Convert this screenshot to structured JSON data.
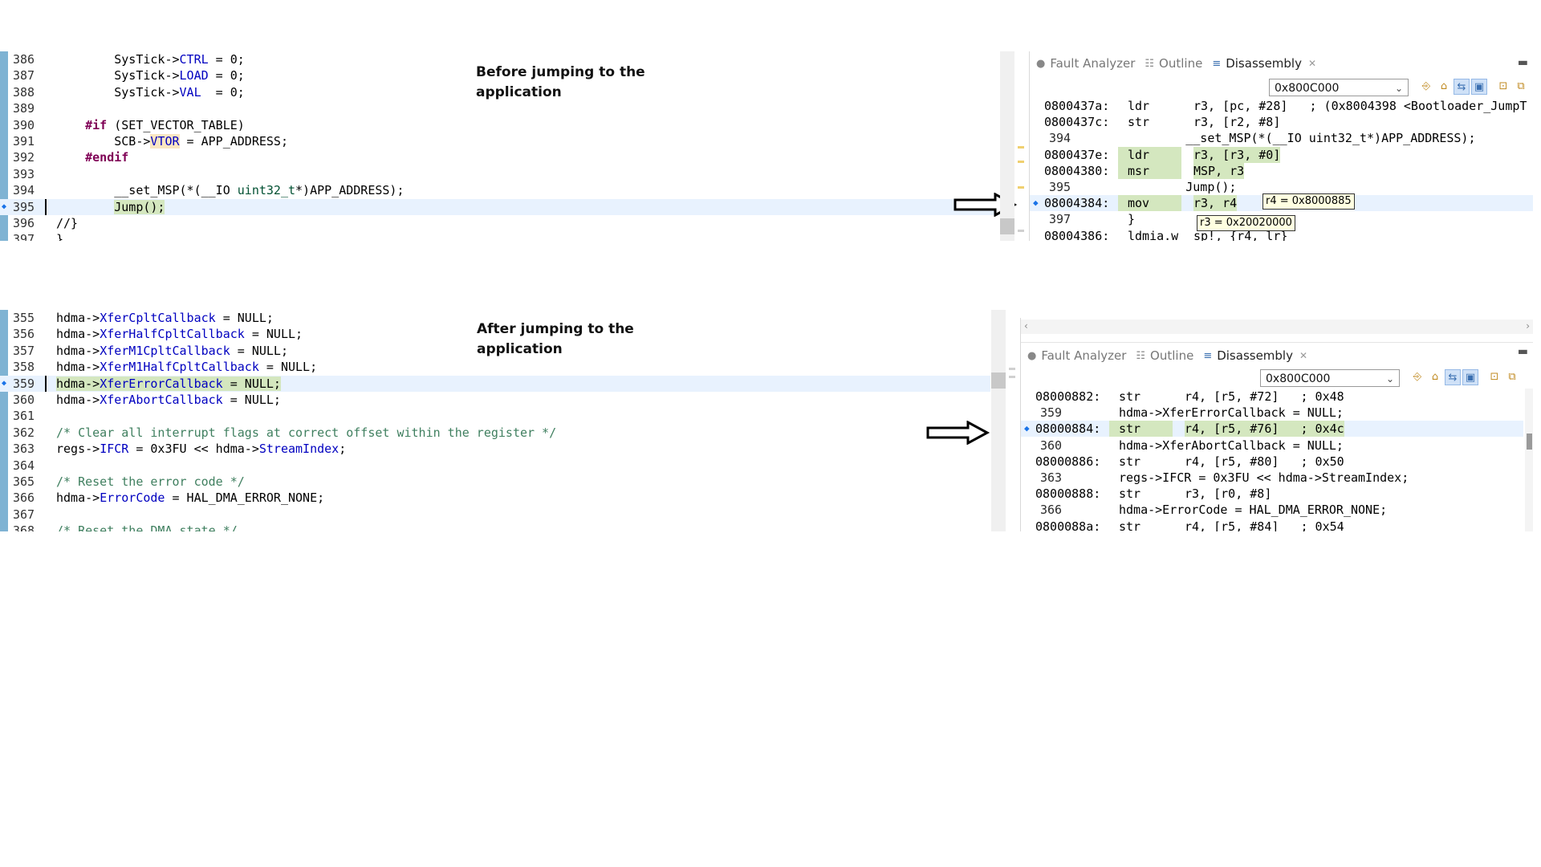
{
  "top": {
    "note": "Before jumping to the application",
    "editor": {
      "lines": [
        {
          "n": "386",
          "html": "        SysTick-><span class=\"fld\">CTRL</span> = 0;"
        },
        {
          "n": "387",
          "html": "        SysTick-><span class=\"fld\">LOAD</span> = 0;"
        },
        {
          "n": "388",
          "html": "        SysTick-><span class=\"fld\">VAL</span>  = 0;"
        },
        {
          "n": "389",
          "html": ""
        },
        {
          "n": "390",
          "html": "    <span class=\"kw\">#if</span> (SET_VECTOR_TABLE)"
        },
        {
          "n": "391",
          "html": "        SCB-><span class=\"vtor\">VTOR</span> = APP_ADDRESS;"
        },
        {
          "n": "392",
          "html": "    <span class=\"kw\">#endif</span>"
        },
        {
          "n": "393",
          "html": ""
        },
        {
          "n": "394",
          "html": "        __set_MSP(*(__IO <span class=\"ty\">uint32_t</span>*)APP_ADDRESS);"
        },
        {
          "n": "395",
          "html": "        <span class=\"hl\">Jump();</span>"
        },
        {
          "n": "396",
          "html": "//}"
        },
        {
          "n": "397",
          "html": "}"
        }
      ]
    },
    "disasm": {
      "tabs": [
        "Fault Analyzer",
        "Outline",
        "Disassembly"
      ],
      "address": "0x800C000",
      "rows": [
        {
          "a": "0800437a:",
          "m": "ldr",
          "o": "r3, [pc, #28]   ; (0x8004398 <Bootloader_JumpT"
        },
        {
          "a": "0800437c:",
          "m": "str",
          "o": "r3, [r2, #8]"
        },
        {
          "a": "394",
          "src": "        __set_MSP(*(__IO uint32_t*)APP_ADDRESS);",
          "ln": true
        },
        {
          "a": "0800437e:",
          "m": "ldr",
          "o": "r3, [r3, #0]",
          "hl": true
        },
        {
          "a": "08004380:",
          "m": "msr",
          "o": "MSP, r3",
          "hl": true
        },
        {
          "a": "395",
          "src": "        Jump();",
          "ln": true
        },
        {
          "a": "08004384:",
          "m": "mov",
          "o": "r3, r4",
          "hl": true,
          "cur": true
        },
        {
          "a": "397",
          "src": "}",
          "ln": true
        },
        {
          "a": "08004386:",
          "m": "ldmia.w",
          "o": "sp!, {r4, lr}"
        }
      ],
      "tip1": "r4 = 0x8000885",
      "tip2": "r3 = 0x20020000"
    }
  },
  "bottom": {
    "note": "After jumping to the application",
    "editor": {
      "lines": [
        {
          "n": "355",
          "html": "hdma-><span class=\"fld\">XferCpltCallback</span> = NULL;"
        },
        {
          "n": "356",
          "html": "hdma-><span class=\"fld\">XferHalfCpltCallback</span> = NULL;"
        },
        {
          "n": "357",
          "html": "hdma-><span class=\"fld\">XferM1CpltCallback</span> = NULL;"
        },
        {
          "n": "358",
          "html": "hdma-><span class=\"fld\">XferM1HalfCpltCallback</span> = NULL;"
        },
        {
          "n": "359",
          "html": "<span class=\"hl\">hdma-><span class=\"fld\">XferErrorCallback</span> = NULL;</span>"
        },
        {
          "n": "360",
          "html": "hdma-><span class=\"fld\">XferAbortCallback</span> = NULL;"
        },
        {
          "n": "361",
          "html": ""
        },
        {
          "n": "362",
          "html": "<span class=\"cm\">/* Clear all interrupt flags at correct offset within the register */</span>"
        },
        {
          "n": "363",
          "html": "regs-><span class=\"fld\">IFCR</span> = 0x3FU &lt;&lt; hdma-><span class=\"fld\">StreamIndex</span>;"
        },
        {
          "n": "364",
          "html": ""
        },
        {
          "n": "365",
          "html": "<span class=\"cm\">/* Reset the error code */</span>"
        },
        {
          "n": "366",
          "html": "hdma-><span class=\"fld\">ErrorCode</span> = HAL_DMA_ERROR_NONE;"
        },
        {
          "n": "367",
          "html": ""
        },
        {
          "n": "368",
          "html": "<span class=\"cm\">/* Reset the DMA state */</span>"
        }
      ]
    },
    "disasm": {
      "tabs": [
        "Fault Analyzer",
        "Outline",
        "Disassembly"
      ],
      "address": "0x800C000",
      "rows": [
        {
          "a": "08000882:",
          "m": "str",
          "o": "r4, [r5, #72]   ; 0x48"
        },
        {
          "a": "359",
          "src": "hdma->XferErrorCallback = NULL;",
          "ln": true
        },
        {
          "a": "08000884:",
          "m": "str",
          "o": "r4, [r5, #76]   ; 0x4c",
          "hl": true,
          "cur": true
        },
        {
          "a": "360",
          "src": "hdma->XferAbortCallback = NULL;",
          "ln": true
        },
        {
          "a": "08000886:",
          "m": "str",
          "o": "r4, [r5, #80]   ; 0x50"
        },
        {
          "a": "363",
          "src": "regs->IFCR = 0x3FU << hdma->StreamIndex;",
          "ln": true
        },
        {
          "a": "08000888:",
          "m": "str",
          "o": "r3, [r0, #8]"
        },
        {
          "a": "366",
          "src": "hdma->ErrorCode = HAL_DMA_ERROR_NONE;",
          "ln": true
        },
        {
          "a": "0800088a:",
          "m": "str",
          "o": "r4, [r5, #84]   ; 0x54"
        }
      ]
    }
  },
  "icons": {
    "tab_fault": "fault-analyzer-icon",
    "tab_outline": "outline-icon",
    "tab_disasm": "disassembly-icon",
    "arrow": "right-arrow-icon"
  },
  "colors": {
    "gutter": "#7fb3d3",
    "current_line": "#e8f2fe",
    "highlight": "#d4e7bf",
    "field": "#0000c0",
    "keyword": "#7f0055",
    "comment": "#3f7f5f"
  }
}
